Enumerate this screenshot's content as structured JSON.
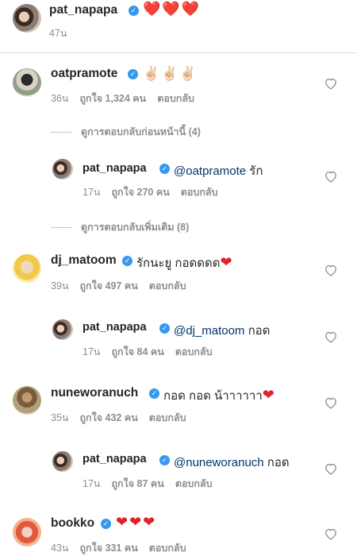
{
  "post": {
    "username": "pat_napapa",
    "caption_emoji": "❤️❤️❤️",
    "time": "47น"
  },
  "labels": {
    "likes_prefix": "ถูกใจ",
    "likes_suffix": "คน",
    "reply": "ตอบกลับ"
  },
  "comments": [
    {
      "username": "oatpramote",
      "text": "✌🏻✌🏻✌🏻",
      "time": "36น",
      "likes": "1,324"
    },
    {
      "username": "pat_napapa",
      "mention": "@oatpramote",
      "text": " รัก",
      "time": "17น",
      "likes": "270"
    },
    {
      "username": "dj_matoom",
      "text": "รักนะยู กอดดดด",
      "time": "39น",
      "likes": "497"
    },
    {
      "username": "pat_napapa",
      "mention": "@dj_matoom",
      "text": " กอด",
      "time": "17น",
      "likes": "84"
    },
    {
      "username": "nuneworanuch",
      "text": "กอด กอด น้าาาาาา",
      "time": "35น",
      "likes": "432"
    },
    {
      "username": "pat_napapa",
      "mention": "@nuneworanuch",
      "text": " กอด",
      "time": "17น",
      "likes": "87"
    },
    {
      "username": "bookko",
      "text": "",
      "time": "43น",
      "likes": "331"
    }
  ],
  "view_replies": {
    "previous": "ดูการตอบกลับก่อนหน้านี้ (4)",
    "more": "ดูการตอบกลับเพิ่มเติม (8)"
  },
  "colors": {
    "verified": "#3897f0",
    "heart": "#e1222a",
    "mention": "#003569",
    "meta": "#8e8e8e"
  }
}
